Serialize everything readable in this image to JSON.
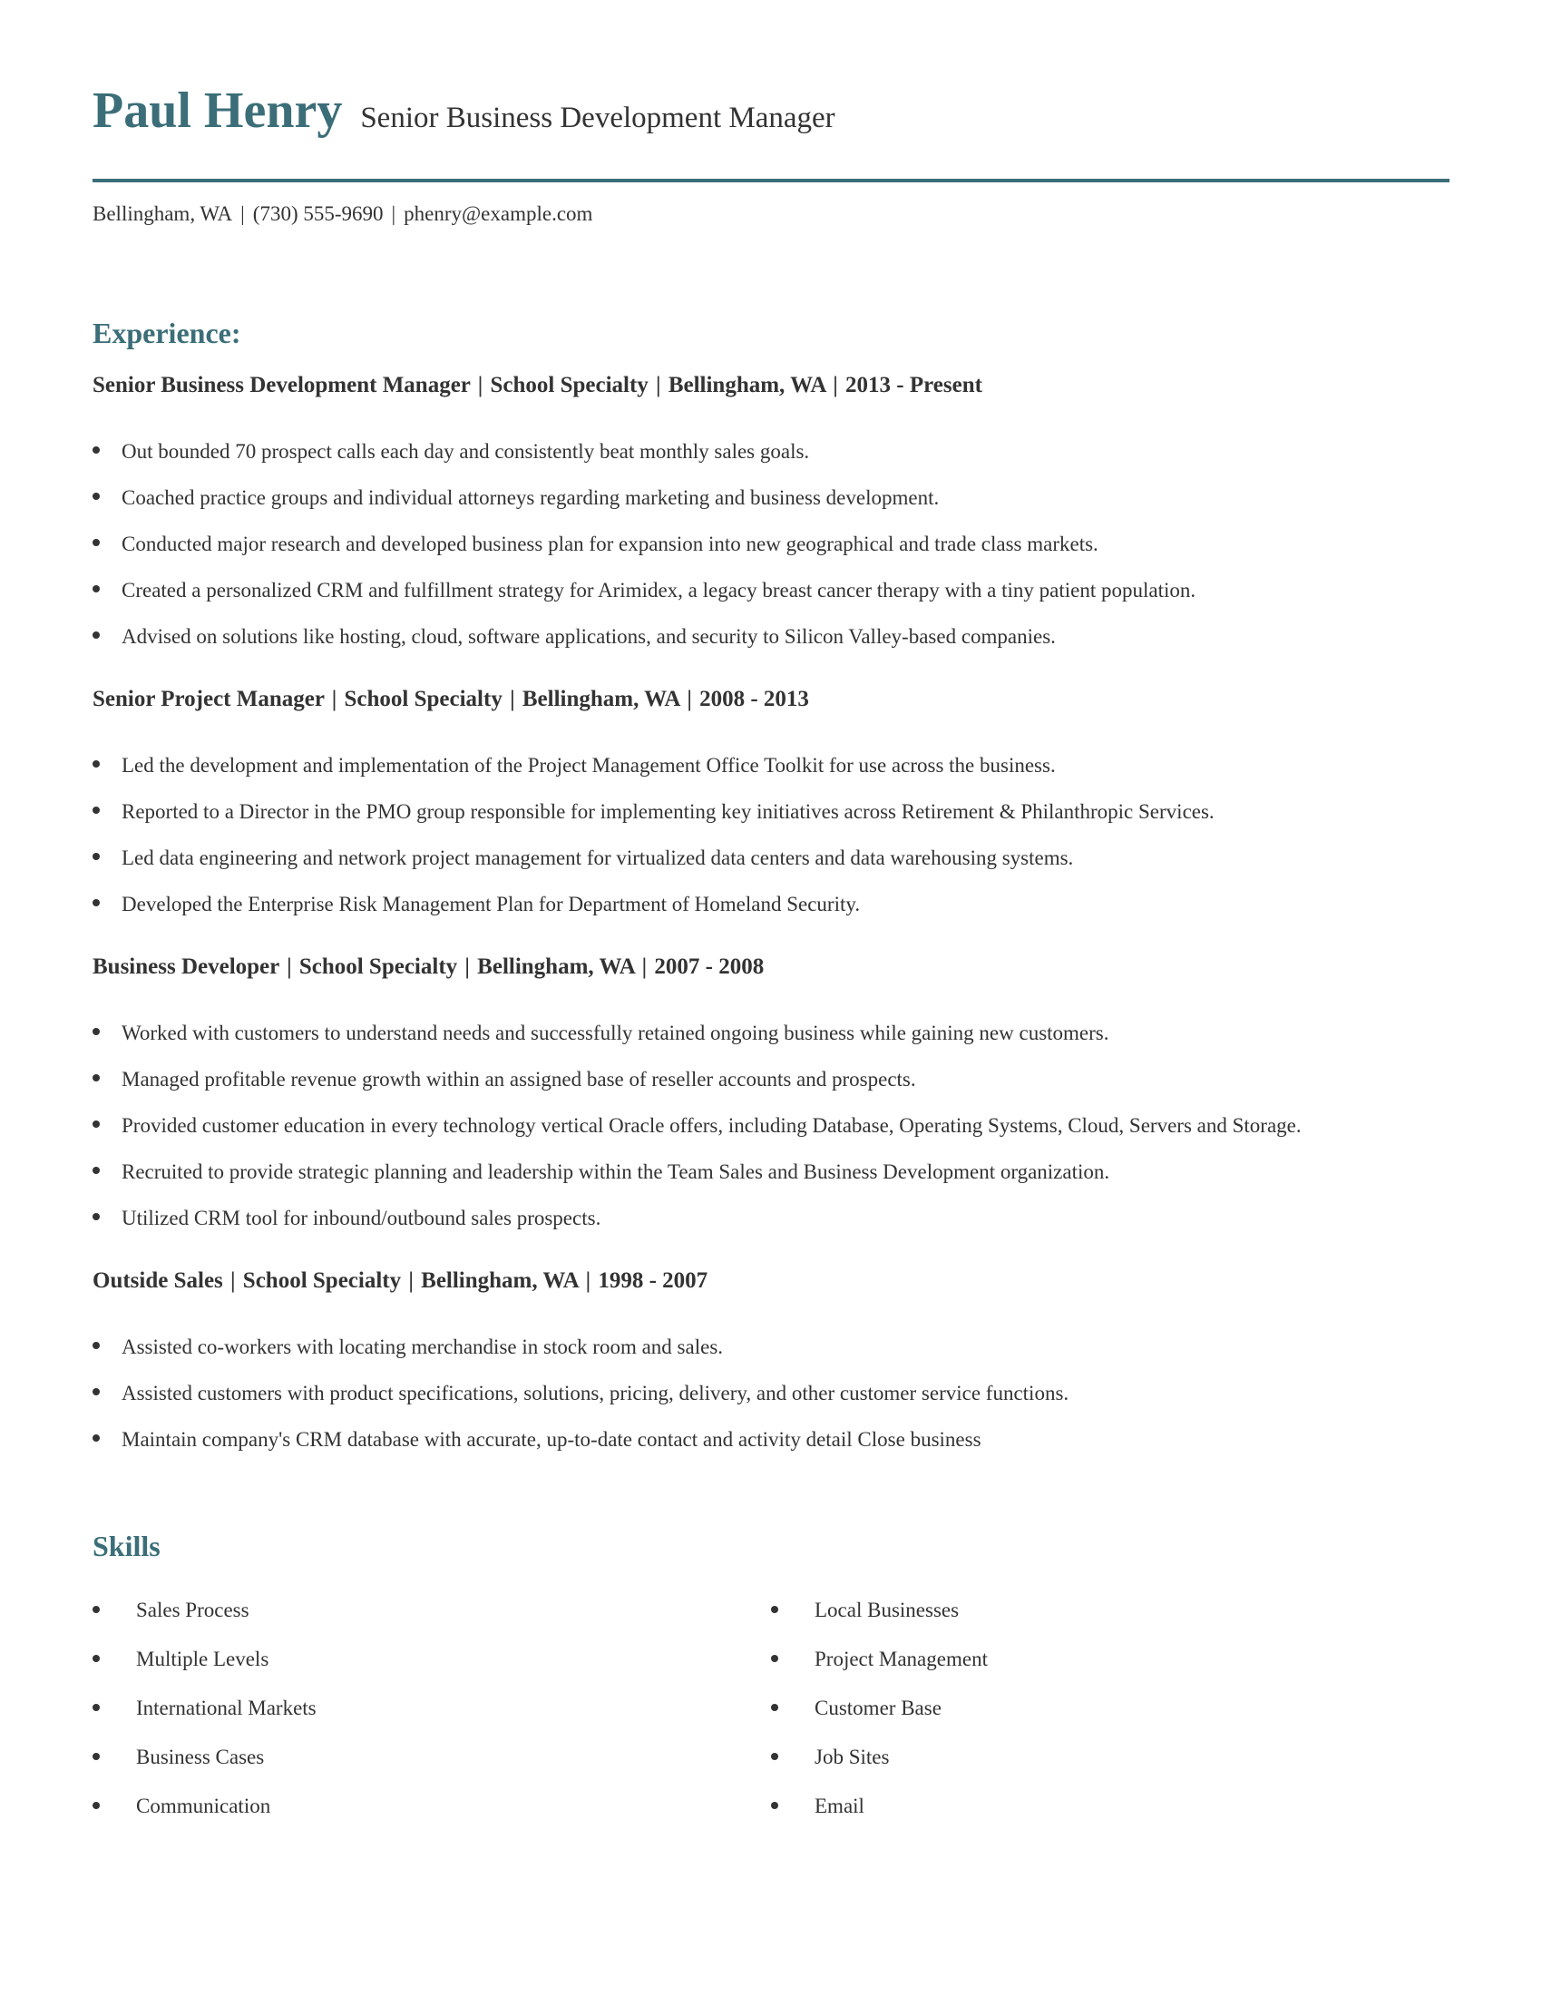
{
  "header": {
    "name": "Paul Henry",
    "title": "Senior Business Development Manager",
    "contact": {
      "location": "Bellingham, WA",
      "phone": "(730) 555-9690",
      "email": "phenry@example.com",
      "separator": "|"
    }
  },
  "colors": {
    "accent": "#3b6e78",
    "text": "#333333"
  },
  "experience": {
    "heading": "Experience:",
    "jobs": [
      {
        "role": "Senior Business Development Manager",
        "company": "School Specialty",
        "location": "Bellingham, WA",
        "dates": "2013 - Present",
        "bullets": [
          "Out bounded 70 prospect calls each day and consistently beat monthly sales goals.",
          "Coached practice groups and individual attorneys regarding marketing and business development.",
          "Conducted major research and developed business plan for expansion into new geographical and trade class markets.",
          "Created a personalized CRM and fulfillment strategy for Arimidex, a legacy breast cancer therapy with a tiny patient population.",
          "Advised on solutions like hosting, cloud, software applications, and security to Silicon Valley-based companies."
        ]
      },
      {
        "role": "Senior Project Manager",
        "company": "School Specialty",
        "location": "Bellingham, WA",
        "dates": "2008 - 2013",
        "bullets": [
          "Led the development and implementation of the Project Management Office Toolkit for use across the business.",
          "Reported to a Director in the PMO group responsible for implementing key initiatives across Retirement & Philanthropic Services.",
          "Led data engineering and network project management for virtualized data centers and data warehousing systems.",
          "Developed the Enterprise Risk Management Plan for Department of Homeland Security."
        ]
      },
      {
        "role": "Business Developer",
        "company": "School Specialty",
        "location": "Bellingham, WA",
        "dates": "2007 - 2008",
        "bullets": [
          "Worked with customers to understand needs and successfully retained ongoing business while gaining new customers.",
          "Managed profitable revenue growth within an assigned base of reseller accounts and prospects.",
          "Provided customer education in every technology vertical Oracle offers, including Database, Operating Systems, Cloud, Servers and Storage.",
          "Recruited to provide strategic planning and leadership within the Team Sales and Business Development organization.",
          "Utilized CRM tool for inbound/outbound sales prospects."
        ]
      },
      {
        "role": "Outside Sales",
        "company": "School Specialty",
        "location": "Bellingham, WA",
        "dates": "1998 - 2007",
        "bullets": [
          "Assisted co-workers with locating merchandise in stock room and sales.",
          "Assisted customers with product specifications, solutions, pricing, delivery, and other customer service functions.",
          "Maintain company's CRM database with accurate, up-to-date contact and activity detail Close business"
        ]
      }
    ]
  },
  "skills": {
    "heading": "Skills",
    "left": [
      "Sales Process",
      "Multiple Levels",
      "International Markets",
      "Business Cases",
      "Communication"
    ],
    "right": [
      "Local Businesses",
      "Project Management",
      "Customer Base",
      "Job Sites",
      "Email"
    ]
  }
}
